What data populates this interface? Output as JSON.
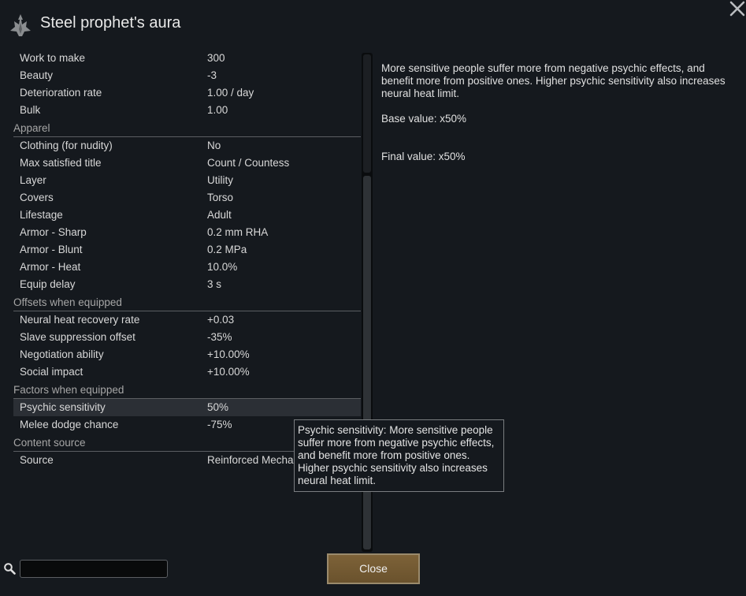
{
  "window": {
    "title": "Steel prophet's aura",
    "title_icon": "psychic-headgear-icon",
    "close_icon": "close-x-icon"
  },
  "stats": {
    "rows_top": [
      {
        "label": "Work to make",
        "value": "300"
      },
      {
        "label": "Beauty",
        "value": "-3"
      },
      {
        "label": "Deterioration rate",
        "value": "1.00 / day"
      },
      {
        "label": "Bulk",
        "value": "1.00"
      }
    ],
    "apparel": {
      "header": "Apparel",
      "rows": [
        {
          "label": "Clothing (for nudity)",
          "value": "No"
        },
        {
          "label": "Max satisfied title",
          "value": "Count / Countess"
        },
        {
          "label": "Layer",
          "value": "Utility"
        },
        {
          "label": "Covers",
          "value": "Torso"
        },
        {
          "label": "Lifestage",
          "value": "Adult"
        },
        {
          "label": "Armor - Sharp",
          "value": "0.2 mm RHA"
        },
        {
          "label": "Armor - Blunt",
          "value": "0.2 MPa"
        },
        {
          "label": "Armor - Heat",
          "value": "10.0%"
        },
        {
          "label": "Equip delay",
          "value": "3 s"
        }
      ]
    },
    "offsets": {
      "header": "Offsets when equipped",
      "rows": [
        {
          "label": "Neural heat recovery rate",
          "value": "+0.03"
        },
        {
          "label": "Slave suppression offset",
          "value": "-35%"
        },
        {
          "label": "Negotiation ability",
          "value": "+10.00%"
        },
        {
          "label": "Social impact",
          "value": "+10.00%"
        }
      ]
    },
    "factors": {
      "header": "Factors when equipped",
      "rows": [
        {
          "label": "Psychic sensitivity",
          "value": "50%"
        },
        {
          "label": "Melee dodge chance",
          "value": "-75%"
        }
      ]
    },
    "content_source": {
      "header": "Content source",
      "rows": [
        {
          "label": "Source",
          "value": "Reinforced Mechanoid 2"
        }
      ]
    }
  },
  "description": {
    "text": "More sensitive people suffer more from negative psychic effects, and benefit more from positive ones. Higher psychic sensitivity also increases neural heat limit.",
    "base_value": "Base value: x50%",
    "final_value": "Final value: x50%"
  },
  "tooltip": {
    "text": "Psychic sensitivity: More sensitive people suffer more from negative psychic effects, and benefit more from positive ones. Higher psychic sensitivity also increases neural heat limit."
  },
  "search": {
    "icon": "search-icon",
    "value": "",
    "placeholder": ""
  },
  "buttons": {
    "close_label": "Close"
  },
  "colors": {
    "background": "#15191e",
    "close_button": "#7d6238",
    "highlight_row": "#2b2f35"
  }
}
